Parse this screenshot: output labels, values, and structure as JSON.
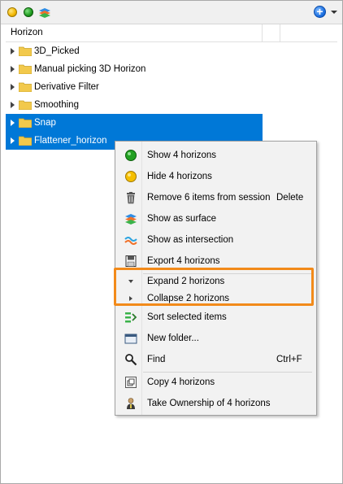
{
  "toolbar": {
    "left_icons": [
      "show-all-icon",
      "hide-all-icon",
      "surface-icon"
    ],
    "right_icons": [
      "add-icon",
      "dropdown-icon"
    ]
  },
  "header": {
    "column_title": "Horizon"
  },
  "tree": {
    "items": [
      {
        "label": "3D_Picked",
        "selected": false
      },
      {
        "label": "Manual picking 3D Horizon",
        "selected": false
      },
      {
        "label": "Derivative Filter",
        "selected": false
      },
      {
        "label": "Smoothing",
        "selected": false
      },
      {
        "label": "Snap",
        "selected": true
      },
      {
        "label": "Flattener_horizon",
        "selected": true
      }
    ]
  },
  "context_menu": {
    "items": [
      {
        "label": "Show 4 horizons",
        "shortcut": "",
        "icon": "green-dot-icon"
      },
      {
        "label": "Hide 4 horizons",
        "shortcut": "",
        "icon": "yellow-dot-icon"
      },
      {
        "label": "Remove 6 items from session",
        "shortcut": "Delete",
        "icon": "trash-icon"
      },
      {
        "label": "Show as surface",
        "shortcut": "",
        "icon": "surface-icon"
      },
      {
        "label": "Show as intersection",
        "shortcut": "",
        "icon": "intersection-icon"
      },
      {
        "label": "Export 4 horizons",
        "shortcut": "",
        "icon": "export-icon"
      },
      {
        "label": "Expand 2 horizons",
        "shortcut": "",
        "icon": "expand-arrow-icon"
      },
      {
        "label": "Collapse 2 horizons",
        "shortcut": "",
        "icon": "collapse-arrow-icon"
      },
      {
        "label": "Sort selected items",
        "shortcut": "",
        "icon": "sort-icon"
      },
      {
        "label": "New folder...",
        "shortcut": "",
        "icon": "new-folder-icon"
      },
      {
        "label": "Find",
        "shortcut": "Ctrl+F",
        "icon": "find-icon"
      },
      {
        "label": "Copy 4 horizons",
        "shortcut": "",
        "icon": "copy-icon"
      },
      {
        "label": "Take Ownership of 4 horizons",
        "shortcut": "",
        "icon": "ownership-icon"
      }
    ]
  },
  "colors": {
    "selection": "#0078d7",
    "highlight": "#f28a1a",
    "menu_bg": "#f2f2f2"
  }
}
